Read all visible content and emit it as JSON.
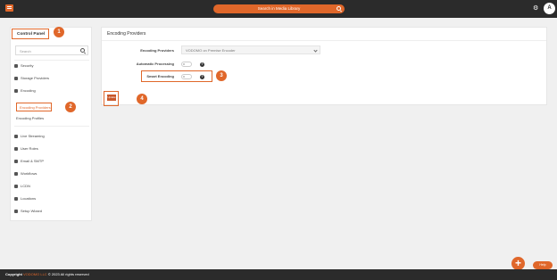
{
  "topbar": {
    "search_label": "Search in Media Library",
    "user_initial": "A"
  },
  "sidebar": {
    "title": "Control Panel",
    "search_placeholder": "Search",
    "items": [
      {
        "label": "Security"
      },
      {
        "label": "Storage Providers"
      },
      {
        "label": "Encoding"
      },
      {
        "label": "Encoding Providers"
      },
      {
        "label": "Encoding Profiles"
      },
      {
        "label": "Live Streaming"
      },
      {
        "label": "User Roles"
      },
      {
        "label": "Email & SMTP"
      },
      {
        "label": "Workflows"
      },
      {
        "label": "LCDN"
      },
      {
        "label": "Locations"
      },
      {
        "label": "Setup Wizard"
      }
    ]
  },
  "panel": {
    "title": "Encoding Providers",
    "provider_label": "Encoding Providers",
    "provider_value": "VODOMO on Premise Encoder",
    "auto_label": "Automatic Processing",
    "smart_label": "Smart Encoding",
    "update_label": "Update"
  },
  "markers": [
    "1",
    "2",
    "3",
    "4"
  ],
  "footer": {
    "prefix": "Copyright",
    "brand": "VODOMO LLC",
    "suffix": "© 2023 All rights reserved"
  },
  "fab": {
    "add": "+",
    "help": "Help"
  },
  "colors": {
    "accent": "#e0672a",
    "topbar": "#2b2b2b",
    "background": "#f0f0f0"
  }
}
